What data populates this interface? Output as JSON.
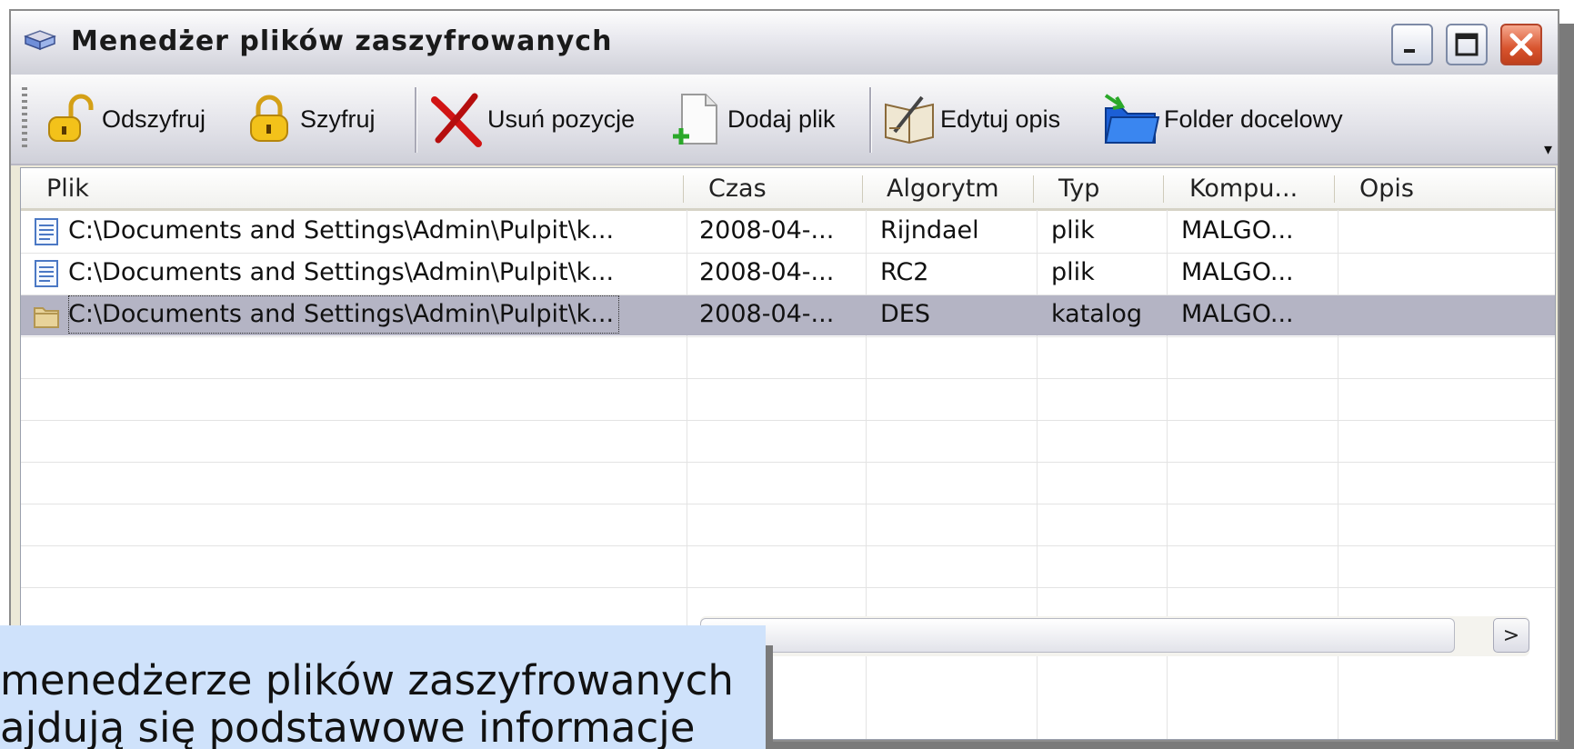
{
  "window": {
    "title": "Menedżer plików zaszyfrowanych"
  },
  "toolbar": {
    "items": [
      {
        "label": "Odszyfruj",
        "icon": "unlocked-padlock-icon"
      },
      {
        "label": "Szyfruj",
        "icon": "locked-padlock-icon"
      },
      {
        "label": "Usuń pozycje",
        "icon": "red-x-icon"
      },
      {
        "label": "Dodaj plik",
        "icon": "add-file-icon"
      },
      {
        "label": "Edytuj opis",
        "icon": "edit-book-icon"
      },
      {
        "label": "Folder docelowy",
        "icon": "blue-folder-icon"
      }
    ],
    "overflow_icon": "chevron-down-icon"
  },
  "list": {
    "columns": [
      "Plik",
      "Czas",
      "Algorytm",
      "Typ",
      "Kompu...",
      "Opis"
    ],
    "rows": [
      {
        "icon": "document-icon",
        "plik": "C:\\Documents and Settings\\Admin\\Pulpit\\k...",
        "czas": "2008-04-...",
        "algorytm": "Rijndael",
        "typ": "plik",
        "komputer": "MALGO...",
        "opis": ""
      },
      {
        "icon": "document-icon",
        "plik": "C:\\Documents and Settings\\Admin\\Pulpit\\k...",
        "czas": "2008-04-...",
        "algorytm": "RC2",
        "typ": "plik",
        "komputer": "MALGO...",
        "opis": ""
      },
      {
        "icon": "folder-icon",
        "plik": "C:\\Documents and Settings\\Admin\\Pulpit\\k...",
        "czas": "2008-04-...",
        "algorytm": "DES",
        "typ": "katalog",
        "komputer": "MALGO...",
        "opis": "",
        "selected": true
      }
    ]
  },
  "scrollbar": {
    "right_arrow": ">"
  },
  "callout": {
    "line1": "menedżerze plików zaszyfrowanych",
    "line2": "ajdują się podstawowe informacje"
  },
  "colors": {
    "selection": "#b4b4c4",
    "callout_background": "#cfe2fb",
    "close_button": "#d8542e"
  }
}
